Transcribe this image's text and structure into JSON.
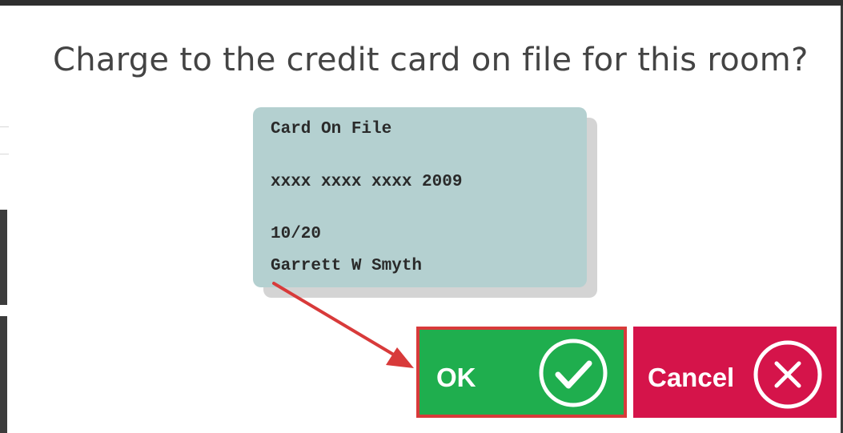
{
  "dialog": {
    "title": "Charge to the credit card on file for this room?"
  },
  "card": {
    "heading": "Card On File",
    "number": "xxxx xxxx xxxx 2009",
    "expiry": "10/20",
    "holder": "Garrett W Smyth"
  },
  "buttons": {
    "ok_label": "OK",
    "ok_icon": "check-circle-icon",
    "cancel_label": "Cancel",
    "cancel_icon": "close-circle-icon"
  },
  "colors": {
    "ok": "#1fae4e",
    "cancel": "#d5144a",
    "card": "#b4d0d0",
    "annotation": "#d83a3a"
  }
}
